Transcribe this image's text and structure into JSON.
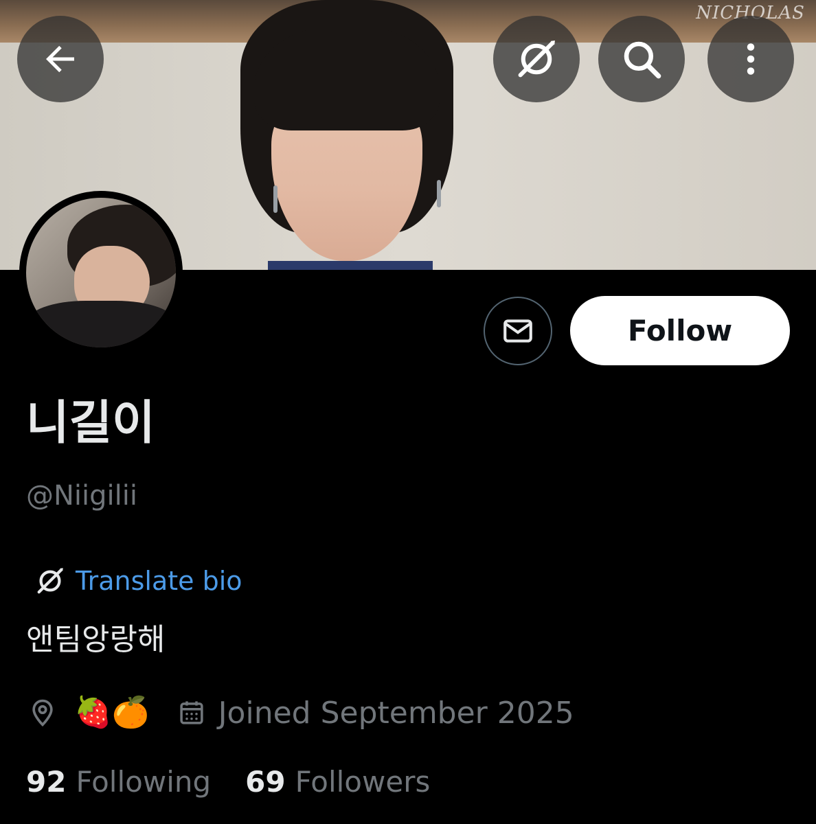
{
  "banner": {
    "watermark": "NICHOLAS"
  },
  "header_buttons": {
    "back_icon": "arrow-left-icon",
    "translate_icon": "translate-icon",
    "search_icon": "search-icon",
    "more_icon": "more-vertical-icon"
  },
  "profile": {
    "display_name": "니길이",
    "handle": "@Niigilii",
    "translate_bio_label": "Translate bio",
    "bio": "앤팀앙랑해",
    "location_emoji": "🍓🍊",
    "joined": "Joined September 2025",
    "following_count": "92",
    "following_label": "Following",
    "followers_count": "69",
    "followers_label": "Followers"
  },
  "actions": {
    "follow_label": "Follow",
    "message_icon": "mail-icon"
  },
  "colors": {
    "background": "#000000",
    "text_primary": "#e7e9ea",
    "text_secondary": "#71767b",
    "link_blue": "#4c9be8",
    "follow_bg": "#ffffff"
  }
}
